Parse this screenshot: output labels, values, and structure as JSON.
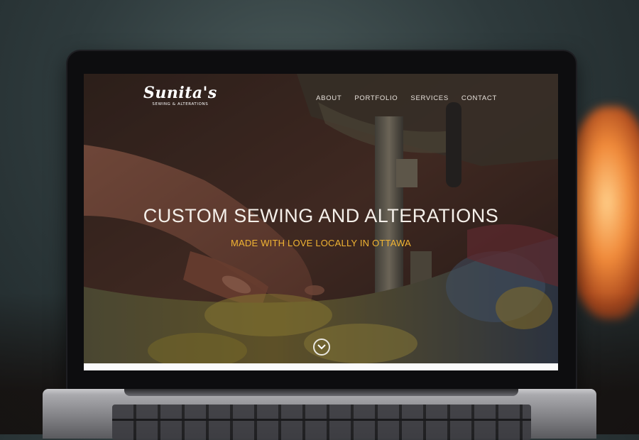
{
  "header": {
    "logo": {
      "script": "Sunita's",
      "subtitle": "Sewing & Alterations"
    },
    "nav": [
      {
        "label": "ABOUT"
      },
      {
        "label": "PORTFOLIO"
      },
      {
        "label": "SERVICES"
      },
      {
        "label": "CONTACT"
      }
    ]
  },
  "hero": {
    "title": "CUSTOM SEWING AND ALTERATIONS",
    "subtitle": "MADE WITH LOVE LOCALLY IN OTTAWA",
    "scroll_icon": "chevron-down-circle-icon"
  },
  "colors": {
    "accent": "#f1b433",
    "text": "#f5f0ea"
  }
}
